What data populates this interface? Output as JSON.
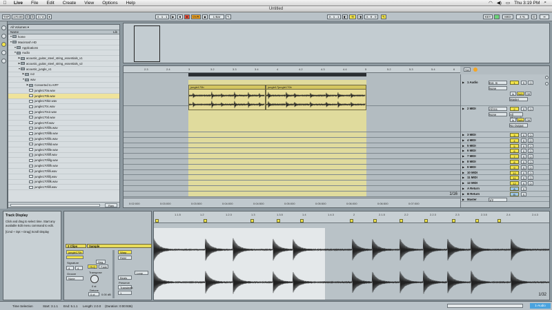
{
  "menubar": {
    "apple": "",
    "items": [
      "Live",
      "File",
      "Edit",
      "Create",
      "View",
      "Options",
      "Help"
    ],
    "clock": "Thu 3:19 PM"
  },
  "window": {
    "title": "Untitled"
  },
  "transport": {
    "tap": "TAP",
    "tempo": "170.00",
    "signature": "4 / 4",
    "metronome": "●",
    "quantize": "1 Bar",
    "position": "4 . 1 . 1",
    "ovr": "OVR",
    "loop_start": "3 . 1 . 1",
    "loop_length": "4 . 0 . 0",
    "key": "KEY",
    "midi": "MIDI",
    "cpu": "4 %",
    "hw": "D"
  },
  "browser": {
    "location": "All Volumes",
    "column": "Name",
    "column_right": "Lib",
    "rows": [
      {
        "indent": 0,
        "name": "home",
        "type": "folder"
      },
      {
        "indent": 0,
        "name": "Macintosh HD",
        "type": "folder"
      },
      {
        "indent": 1,
        "name": "Applications",
        "type": "folder"
      },
      {
        "indent": 1,
        "name": "Audio",
        "type": "folder"
      },
      {
        "indent": 2,
        "name": "acoustic_guitar_steel_string_essentials_v1",
        "type": "folder"
      },
      {
        "indent": 2,
        "name": "acoustic_guitar_steel_string_essentials_v2",
        "type": "folder"
      },
      {
        "indent": 2,
        "name": "acoustic_jungle_v1",
        "type": "folder"
      },
      {
        "indent": 3,
        "name": "rx2",
        "type": "folder"
      },
      {
        "indent": 3,
        "name": "wav",
        "type": "folder"
      },
      {
        "indent": 4,
        "name": "Converted to AIFF",
        "type": "folder"
      },
      {
        "indent": 4,
        "name": "jungle170a.wav",
        "type": "wav"
      },
      {
        "indent": 4,
        "name": "jungle170b.wav",
        "type": "wav",
        "selected": true
      },
      {
        "indent": 4,
        "name": "jungle170b2.wav",
        "type": "wav"
      },
      {
        "indent": 4,
        "name": "jungle170c.wav",
        "type": "wav"
      },
      {
        "indent": 4,
        "name": "jungle170c2.wav",
        "type": "wav"
      },
      {
        "indent": 4,
        "name": "jungle170d.wav",
        "type": "wav"
      },
      {
        "indent": 4,
        "name": "jungle170f.wav",
        "type": "wav"
      },
      {
        "indent": 4,
        "name": "jungle170fills.wav",
        "type": "wav"
      },
      {
        "indent": 4,
        "name": "jungle170fillb.wav",
        "type": "wav"
      },
      {
        "indent": 4,
        "name": "jungle170fillc.wav",
        "type": "wav"
      },
      {
        "indent": 4,
        "name": "jungle170filld.wav",
        "type": "wav"
      },
      {
        "indent": 4,
        "name": "jungle170fille.wav",
        "type": "wav"
      },
      {
        "indent": 4,
        "name": "jungle170fillf.wav",
        "type": "wav"
      },
      {
        "indent": 4,
        "name": "jungle170fillg.wav",
        "type": "wav"
      },
      {
        "indent": 4,
        "name": "jungle170fillh.wav",
        "type": "wav"
      },
      {
        "indent": 4,
        "name": "jungle170filli.wav",
        "type": "wav"
      },
      {
        "indent": 4,
        "name": "jungle170fillj.wav",
        "type": "wav"
      },
      {
        "indent": 4,
        "name": "jungle170fillk.wav",
        "type": "wav"
      },
      {
        "indent": 4,
        "name": "jungle170filll.wav",
        "type": "wav"
      }
    ],
    "preview": "Raw"
  },
  "arrangement": {
    "ruler_ticks": [
      "2.3",
      "2.4",
      "3",
      "3.2",
      "3.3",
      "3.4",
      "4",
      "4.2",
      "4.3",
      "4.4",
      "5",
      "5.2",
      "5.3",
      "5.4",
      "6"
    ],
    "time_ticks": [
      "0:02:000",
      "0:03:000",
      "0:03:500",
      "0:04:000",
      "0:04:500",
      "0:05:000",
      "0:05:500",
      "0:06:000",
      "0:06:500",
      "0:07:000"
    ],
    "clip_name_1": "jungle170b",
    "clip_name_2": "jungle17jungle170b",
    "page": "1/16",
    "tracks": [
      {
        "name": "1 Audio",
        "num": "1",
        "input": "Ext. In",
        "channel": "None",
        "monitor_in": "In",
        "monitor_auto": "Auto",
        "monitor_off": "Off",
        "route": "Master"
      },
      {
        "name": "2 MIDI",
        "num": "2",
        "input": "All Ins",
        "channel": "None",
        "sub_channel": "All Channels",
        "monitor_in": "In",
        "monitor_auto": "Auto",
        "monitor_off": "Off",
        "route": "No Output"
      },
      {
        "name": "3 MIDI",
        "num": "3"
      },
      {
        "name": "4 MIDI",
        "num": "4"
      },
      {
        "name": "5 MIDI",
        "num": "5"
      },
      {
        "name": "6 MIDI",
        "num": "6"
      },
      {
        "name": "7 MIDI",
        "num": "7"
      },
      {
        "name": "8 MIDI",
        "num": "8"
      },
      {
        "name": "9 MIDI",
        "num": "9"
      },
      {
        "name": "10 MIDI",
        "num": "10"
      },
      {
        "name": "11 MIDI",
        "num": "11"
      },
      {
        "name": "12 MIDI",
        "num": "12"
      }
    ],
    "returns": [
      {
        "name": "A Return",
        "num": "A"
      },
      {
        "name": "B Return",
        "num": "B"
      }
    ],
    "master": {
      "name": "Master",
      "value": "1/2"
    },
    "solo": "S",
    "arm": "O",
    "set": "Set"
  },
  "info_view": {
    "title": "Track Display",
    "body1": "Click and drag to select time. Start any available Edit menu command to edit.",
    "body2": "[Cmd + Opt + Drag] Scroll Display"
  },
  "clip_view": {
    "clip_header": "2 Clips",
    "clip_name": "jungle170b",
    "signature_label": "Signature",
    "sig_num": "4",
    "sig_den": "4",
    "groove_label": "Groove",
    "groove": "None",
    "sample_header": "Sample",
    "warp": "Warp",
    "seg_bpm": "Seg",
    "hiq": "Hi-Q",
    "fade": "Fade",
    "ram": "RAM",
    "transpose_label": "Transpose",
    "transpose": "0 st",
    "detune_label": "Detune",
    "detune": "0 ct",
    "gain": "0.00 dB",
    "beats": "Beats",
    "preserve_label": "Preserve",
    "preserve": "Transients",
    "loop_mode": "1",
    "loop_btn": "Loop"
  },
  "sample_editor": {
    "ruler_ticks": [
      "1.1.5",
      "1.2",
      "1.2.3",
      "1.3",
      "1.3.5",
      "1.4",
      "1.4.3",
      "2",
      "2.1.5",
      "2.2",
      "2.2.3",
      "2.3",
      "2.3.5",
      "2.4",
      "2.4.3"
    ],
    "page": "1/32"
  },
  "status": {
    "label": "Time Selection",
    "start": "Start: 3.1.1",
    "end": "End: 5.1.1",
    "length": "Length: 2.0.0",
    "duration": "(Duration: 0:00:936)",
    "midi_track": "1-Audio"
  },
  "colors": {
    "accent_yellow": "#f2e34a",
    "selection": "#e8e096",
    "midi_blue": "#4aa3df"
  }
}
